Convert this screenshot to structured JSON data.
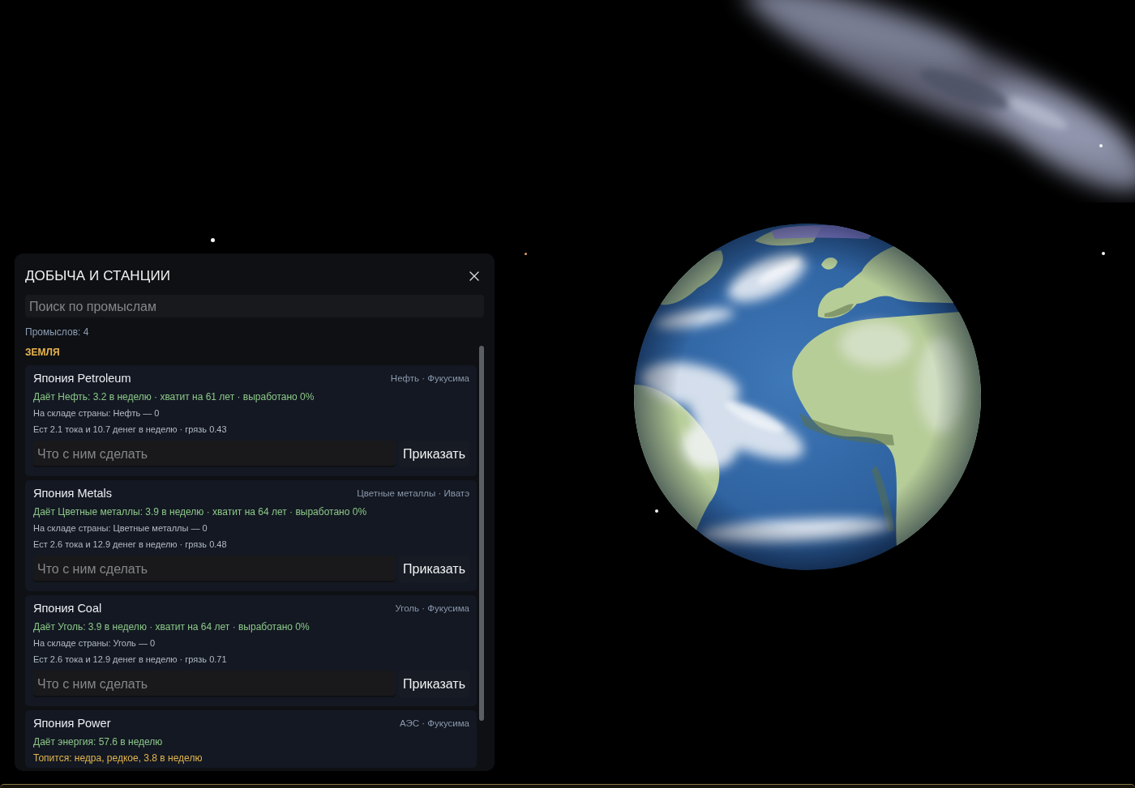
{
  "panel": {
    "title": "ДОБЫЧА И СТАНЦИИ",
    "search": {
      "placeholder": "Поиск по промыслам"
    },
    "count": "Промыслов: 4",
    "groups": [
      {
        "name": "ЗЕМЛЯ",
        "sites": [
          {
            "name": "Япония Petroleum",
            "meta": "Нефть · Фукусима",
            "lines": [
              {
                "kind": "output",
                "text": "Даёт Нефть: 3.2 в неделю · хватит на 61 лет · выработано 0%"
              },
              {
                "kind": "info",
                "text": "На складе страны: Нефть — 0"
              },
              {
                "kind": "info",
                "text": "Ест 2.1 тока и 10.7 денег в неделю · грязь 0.43"
              }
            ],
            "command": {
              "placeholder": "Что с ним сделать",
              "button": "Приказать"
            }
          },
          {
            "name": "Япония Metals",
            "meta": "Цветные металлы · Иватэ",
            "lines": [
              {
                "kind": "output",
                "text": "Даёт Цветные металлы: 3.9 в неделю · хватит на 64 лет · выработано 0%"
              },
              {
                "kind": "info",
                "text": "На складе страны: Цветные металлы — 0"
              },
              {
                "kind": "info",
                "text": "Ест 2.6 тока и 12.9 денег в неделю · грязь 0.48"
              }
            ],
            "command": {
              "placeholder": "Что с ним сделать",
              "button": "Приказать"
            }
          },
          {
            "name": "Япония Coal",
            "meta": "Уголь · Фукусима",
            "lines": [
              {
                "kind": "output",
                "text": "Даёт Уголь: 3.9 в неделю · хватит на 64 лет · выработано 0%"
              },
              {
                "kind": "info",
                "text": "На складе страны: Уголь — 0"
              },
              {
                "kind": "info",
                "text": "Ест 2.6 тока и 12.9 денег в неделю · грязь 0.71"
              }
            ],
            "command": {
              "placeholder": "Что с ним сделать",
              "button": "Приказать"
            }
          },
          {
            "name": "Япония Power",
            "meta": "АЭС · Фукусима",
            "lines": [
              {
                "kind": "output",
                "text": "Даёт энергия: 57.6 в неделю"
              },
              {
                "kind": "fuel",
                "text": "Топится: недра, редкое, 3.8 в неделю"
              }
            ]
          }
        ]
      }
    ]
  }
}
